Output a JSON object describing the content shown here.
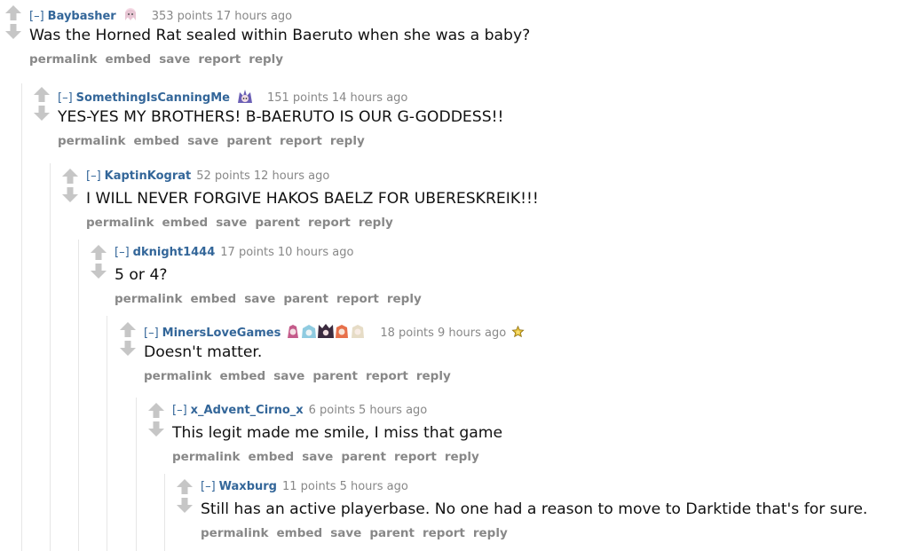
{
  "comments": [
    {
      "collapse_label": "[–]",
      "author": "Baybasher",
      "score": "353 points",
      "time": "17 hours ago",
      "body": "Was the Horned Rat sealed within Baeruto when she was a baby?",
      "actions": [
        "permalink",
        "embed",
        "save",
        "report",
        "reply"
      ]
    },
    {
      "collapse_label": "[–]",
      "author": "SomethingIsCanningMe",
      "score": "151 points",
      "time": "14 hours ago",
      "body": "YES-YES MY BROTHERS! B-BAERUTO IS OUR G-GODDESS!!",
      "actions": [
        "permalink",
        "embed",
        "save",
        "parent",
        "report",
        "reply"
      ]
    },
    {
      "collapse_label": "[–]",
      "author": "KaptinKograt",
      "score": "52 points",
      "time": "12 hours ago",
      "body": "I WILL NEVER FORGIVE HAKOS BAELZ FOR UBERESKREIK!!!",
      "actions": [
        "permalink",
        "embed",
        "save",
        "parent",
        "report",
        "reply"
      ]
    },
    {
      "collapse_label": "[–]",
      "author": "dknight1444",
      "score": "17 points",
      "time": "10 hours ago",
      "body": "5 or 4?",
      "actions": [
        "permalink",
        "embed",
        "save",
        "parent",
        "report",
        "reply"
      ]
    },
    {
      "collapse_label": "[–]",
      "author": "MinersLoveGames",
      "score": "18 points",
      "time": "9 hours ago",
      "body": "Doesn't matter.",
      "actions": [
        "permalink",
        "embed",
        "save",
        "parent",
        "report",
        "reply"
      ]
    },
    {
      "collapse_label": "[–]",
      "author": "x_Advent_Cirno_x",
      "score": "6 points",
      "time": "5 hours ago",
      "body": "This legit made me smile, I miss that game",
      "actions": [
        "permalink",
        "embed",
        "save",
        "parent",
        "report",
        "reply"
      ]
    },
    {
      "collapse_label": "[–]",
      "author": "Waxburg",
      "score": "11 points",
      "time": "5 hours ago",
      "body": "Still has an active playerbase. No one had a reason to move to Darktide that's for sure.",
      "actions": [
        "permalink",
        "embed",
        "save",
        "parent",
        "report",
        "reply"
      ]
    }
  ],
  "icons": {
    "upvote": "upvote-arrow-icon",
    "downvote": "downvote-arrow-icon",
    "award": "gold-award-icon"
  },
  "colors": {
    "author_link": "#336699",
    "muted_text": "#888888",
    "body_text": "#111111",
    "vote_arrow": "#c6c6c6",
    "thread_line": "#e6e6e6"
  }
}
